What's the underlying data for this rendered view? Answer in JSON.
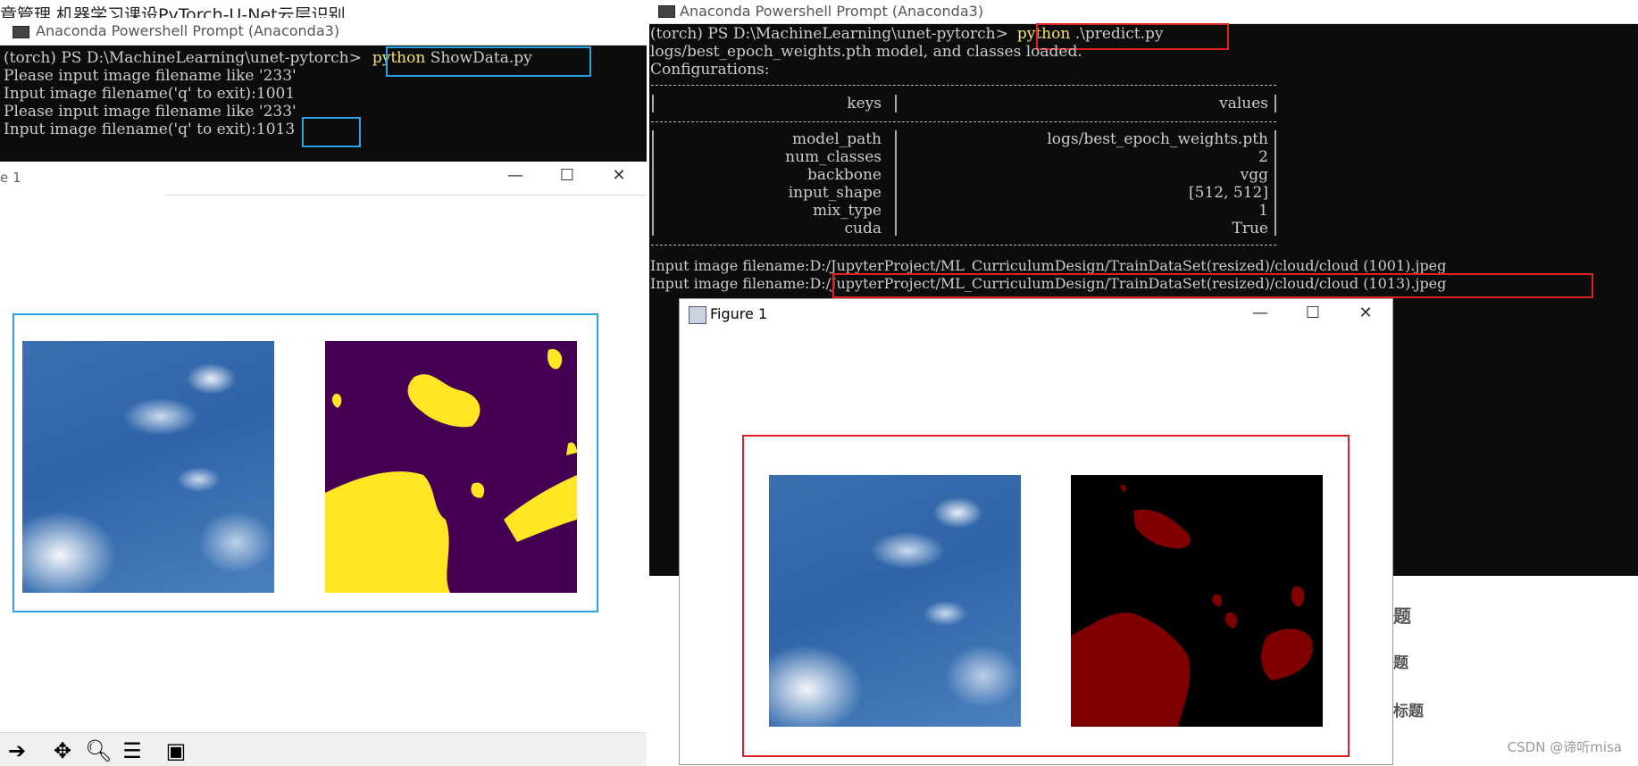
{
  "background": {
    "blog_top_text": "章管理   机器学习课设PyTorch-U-Net云层识别",
    "blog_items": [
      "题",
      "题",
      "标题"
    ],
    "watermark": "CSDN @谛听misa"
  },
  "left_terminal": {
    "title": "Anaconda Powershell Prompt (Anaconda3)",
    "prompt": "(torch) PS D:\\MachineLearning\\unet-pytorch>",
    "command_keyword": "python",
    "command_args": " ShowData.py",
    "lines": [
      "Please input image filename like '233'",
      "Input image filename('q' to exit):1001",
      "Please input image filename like '233'",
      "Input image filename('q' to exit):"
    ],
    "last_input": "1013"
  },
  "left_figure": {
    "title": "e 1",
    "controls": [
      "—",
      "☐",
      "✕"
    ],
    "tools": [
      "arrow-right-icon",
      "move-icon",
      "zoom-icon",
      "sliders-icon",
      "save-icon"
    ],
    "mask_colors": {
      "background": "#440154",
      "foreground": "#fde725"
    }
  },
  "right_terminal": {
    "title": "Anaconda Powershell Prompt (Anaconda3)",
    "prompt": "(torch) PS D:\\MachineLearning\\unet-pytorch>",
    "command_keyword": "python",
    "command_args": " .\\predict.py",
    "loaded_line": "logs/best_epoch_weights.pth model, and classes loaded.",
    "config_label": "Configurations:",
    "separator": "----------------------------------------------------------------------",
    "table_header": {
      "keys": "keys",
      "values": "values"
    },
    "config_rows": [
      {
        "key": "model_path",
        "value": "logs/best_epoch_weights.pth"
      },
      {
        "key": "num_classes",
        "value": "2"
      },
      {
        "key": "backbone",
        "value": "vgg"
      },
      {
        "key": "input_shape",
        "value": "[512, 512]"
      },
      {
        "key": "mix_type",
        "value": "1"
      },
      {
        "key": "cuda",
        "value": "True"
      }
    ],
    "input_label": "Input image filename:",
    "input_paths": [
      "D:/JupyterProject/ML_CurriculumDesign/TrainDataSet(resized)/cloud/cloud (1001).jpeg",
      "D:/JupyterProject/ML_CurriculumDesign/TrainDataSet(resized)/cloud/cloud (1013).jpeg"
    ]
  },
  "right_figure": {
    "title": "Figure 1",
    "controls": [
      "—",
      "☐",
      "✕"
    ],
    "mask_colors": {
      "background": "#000000",
      "foreground": "#800000"
    }
  },
  "accent_colors": {
    "blue_box": "#2aa3e6",
    "red_box": "#e02020",
    "prompt_highlight": "#f5e36a"
  }
}
